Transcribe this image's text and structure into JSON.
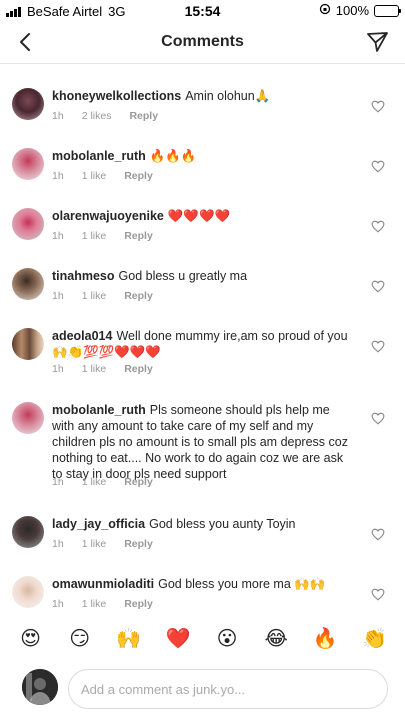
{
  "status_bar": {
    "carrier": "BeSafe Airtel",
    "network": "3G",
    "time": "15:54",
    "battery_percent": "100%",
    "battery_level": 1.0
  },
  "nav": {
    "title": "Comments"
  },
  "comments": [
    {
      "username": "khoneywelkollections",
      "text": "Amin olohun🙏",
      "time": "1h",
      "likes": "2 likes",
      "reply": "Reply"
    },
    {
      "username": "mobolanle_ruth",
      "text": "🔥🔥🔥",
      "time": "1h",
      "likes": "1 like",
      "reply": "Reply"
    },
    {
      "username": "olarenwajuoyenike",
      "text": "❤️❤️❤️❤️",
      "time": "1h",
      "likes": "1 like",
      "reply": "Reply"
    },
    {
      "username": "tinahmeso",
      "text": "God bless u greatly ma",
      "time": "1h",
      "likes": "1 like",
      "reply": "Reply"
    },
    {
      "username": "adeola014",
      "text": "Well done mummy ire,am so proud of you 🙌👏💯💯❤️❤️❤️",
      "time": "1h",
      "likes": "1 like",
      "reply": "Reply"
    },
    {
      "username": "mobolanle_ruth",
      "text": "Pls someone should pls help me with any amount to take care of my self and my children pls no amount is to small pls am depress coz nothing to eat.... No work to do again coz we are ask to stay in door pls need support",
      "time": "1h",
      "likes": "1 like",
      "reply": "Reply"
    },
    {
      "username": "lady_jay_officia",
      "text": "God bless you aunty Toyin",
      "time": "1h",
      "likes": "1 like",
      "reply": "Reply"
    },
    {
      "username": "omawunmioladiti",
      "text": "God bless you more ma 🙌🙌",
      "time": "1h",
      "likes": "1 like",
      "reply": "Reply"
    }
  ],
  "emoji_bar": [
    "😍",
    "😏",
    "🙌",
    "❤️",
    "😮",
    "😂",
    "🔥",
    "👏"
  ],
  "composer": {
    "placeholder": "Add a comment as junk.yo..."
  },
  "colors": {
    "text": "#262626",
    "meta": "#999999",
    "divider": "#e6e6e6",
    "battery": "#4cd964"
  }
}
